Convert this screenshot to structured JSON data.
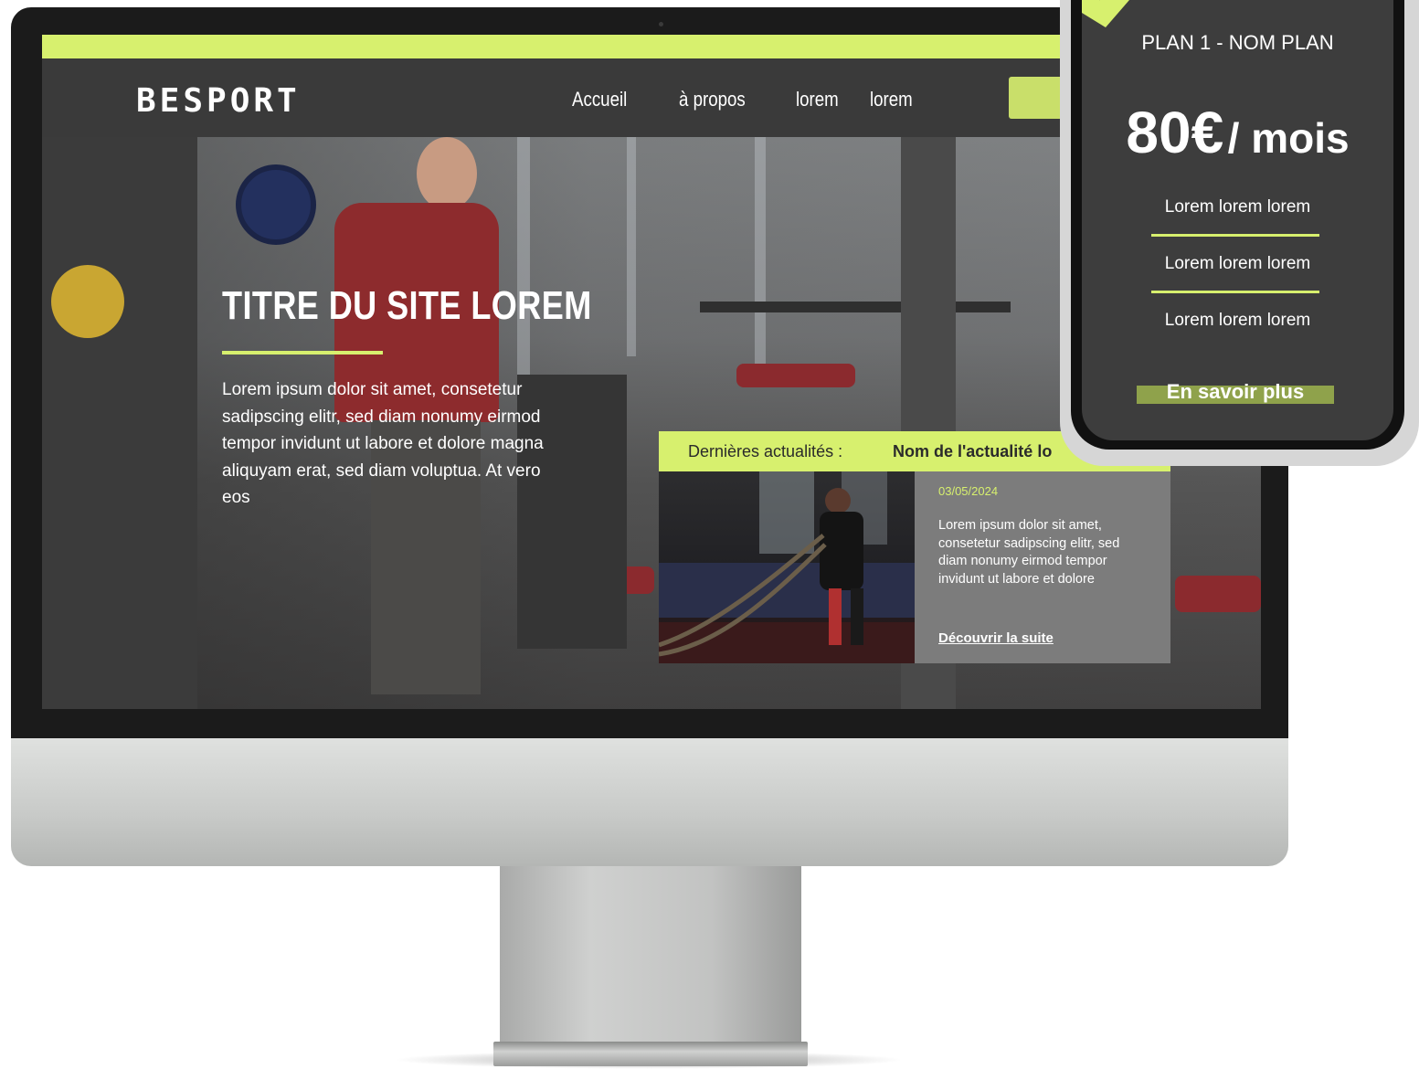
{
  "site": {
    "logo": "BESPORT",
    "nav": [
      "Accueil",
      "à propos",
      "lorem",
      "lorem"
    ]
  },
  "hero": {
    "title": "TITRE DU SITE LOREM",
    "text": "Lorem ipsum dolor sit amet, consetetur sadipscing elitr, sed diam nonumy eirmod tempor invidunt ut labore et dolore magna aliquyam erat, sed diam voluptua. At vero eos"
  },
  "news": {
    "label": "Dernières actualités :",
    "headline": "Nom de l'actualité lo",
    "date": "03/05/2024",
    "text": "Lorem ipsum dolor sit amet, consetetur sadipscing elitr, sed diam nonumy eirmod tempor invidunt ut labore et dolore",
    "link": "Découvrir la suite"
  },
  "plan": {
    "title": "PLAN 1 - NOM PLAN",
    "price": "80€",
    "period": "/ mois",
    "features": [
      "Lorem lorem lorem",
      "Lorem lorem lorem",
      "Lorem lorem lorem"
    ],
    "cta": "En savoir plus"
  },
  "colors": {
    "accent": "#d7f06e",
    "dark": "#3a3a3a",
    "cta_green": "#8fa24b"
  }
}
